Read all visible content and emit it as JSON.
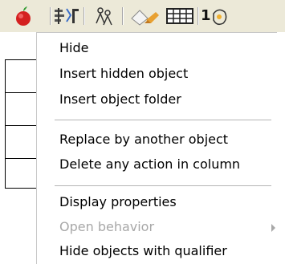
{
  "toolbar": {
    "icons": [
      "red-apple-icon",
      "object-properties-icon",
      "people-icon",
      "eraser-icon",
      "grid-icon",
      "numbered-object-icon"
    ],
    "numbered_icon_digit": "1"
  },
  "context_menu": {
    "groups": [
      {
        "items": [
          {
            "label": "Hide",
            "enabled": true
          },
          {
            "label": "Insert hidden object",
            "enabled": true
          },
          {
            "label": "Insert object folder",
            "enabled": true
          }
        ]
      },
      {
        "items": [
          {
            "label": "Replace by another object",
            "enabled": true
          },
          {
            "label": "Delete any action in column",
            "enabled": true
          }
        ]
      },
      {
        "items": [
          {
            "label": "Display properties",
            "enabled": true
          },
          {
            "label": "Open behavior",
            "enabled": false,
            "has_submenu": true
          },
          {
            "label": "Hide objects with qualifier",
            "enabled": true
          }
        ]
      }
    ]
  },
  "colors": {
    "toolbar_bg": "#ece9d8",
    "disabled_text": "#a8a8a8",
    "apple_red": "#d42020",
    "leaf_green": "#2e9a2e"
  }
}
